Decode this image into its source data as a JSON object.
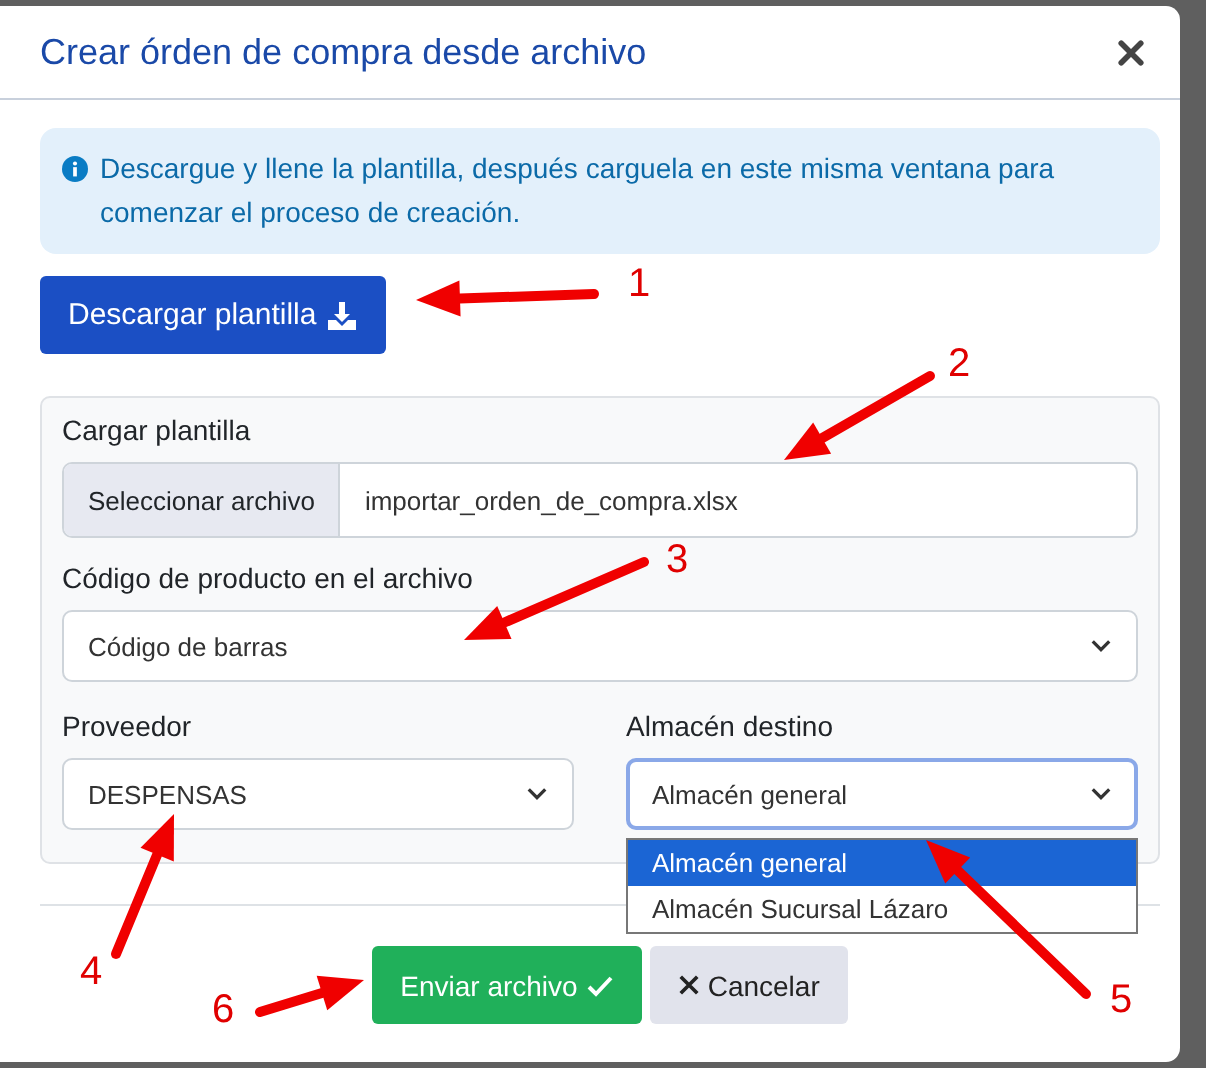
{
  "dialog": {
    "title": "Crear órden de compra desde archivo"
  },
  "info": {
    "text": "Descargue y llene la plantilla, después carguela en este misma ventana para comenzar el proceso de creación."
  },
  "download_button": {
    "label": "Descargar plantilla"
  },
  "form": {
    "file": {
      "label": "Cargar plantilla",
      "button": "Seleccionar archivo",
      "value": "importar_orden_de_compra.xlsx"
    },
    "product_code": {
      "label": "Código de producto en el archivo",
      "value": "Código de barras"
    },
    "supplier": {
      "label": "Proveedor",
      "value": "DESPENSAS"
    },
    "warehouse": {
      "label": "Almacén destino",
      "value": "Almacén general",
      "expanded": true,
      "options": [
        {
          "label": "Almacén general",
          "selected": true
        },
        {
          "label": "Almacén Sucursal Lázaro",
          "selected": false
        }
      ]
    }
  },
  "footer_buttons": [
    {
      "label": "Enviar archivo",
      "kind": "submit"
    },
    {
      "label": "Cancelar",
      "kind": "cancel"
    }
  ],
  "annotations": [
    {
      "label": "1"
    },
    {
      "label": "2"
    },
    {
      "label": "3"
    },
    {
      "label": "4"
    },
    {
      "label": "5"
    },
    {
      "label": "6"
    }
  ]
}
